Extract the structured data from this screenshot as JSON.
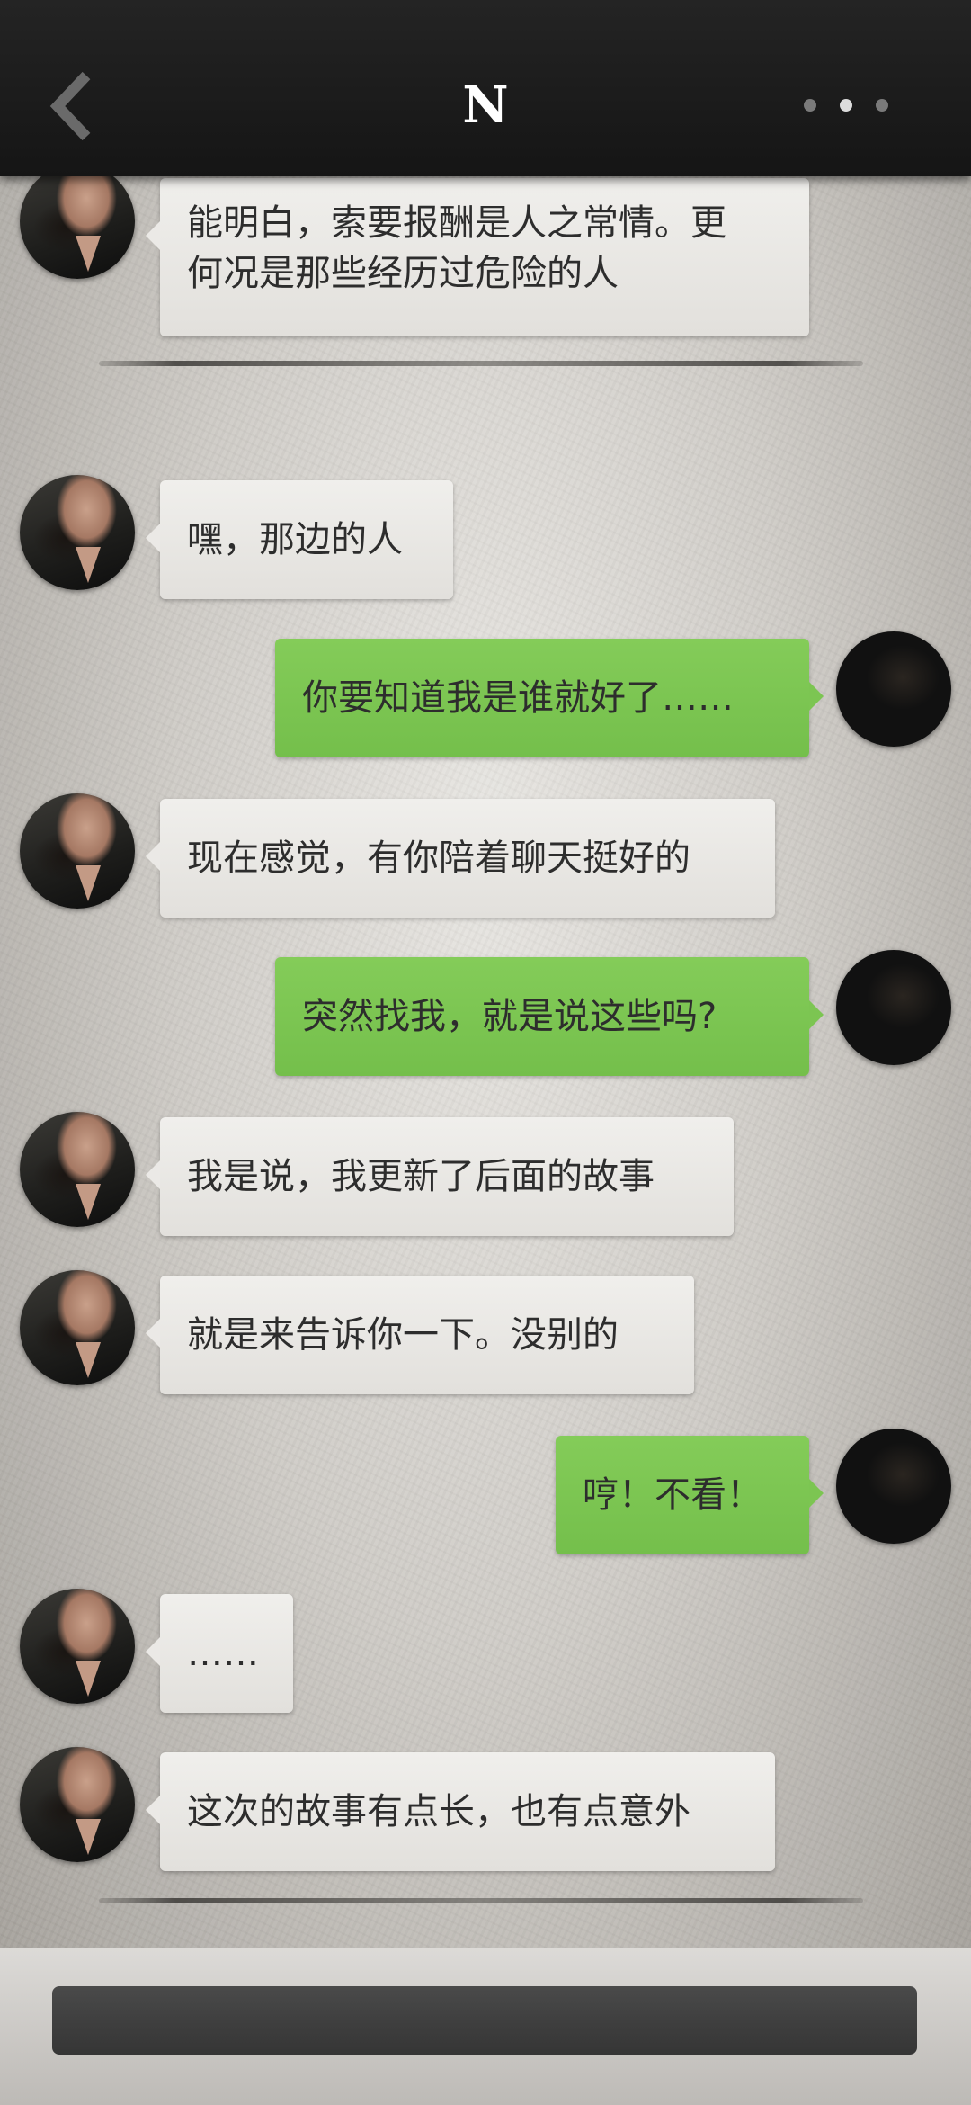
{
  "header": {
    "title": "N",
    "back_icon": "chevron-left-icon",
    "more_icon": "more-dots-icon"
  },
  "messages": [
    {
      "side": "in",
      "text_lines": [
        "能明白，索要报酬是人之常情。更",
        "何况是那些经历过危险的人"
      ]
    },
    {
      "side": "in",
      "text": "嘿，那边的人"
    },
    {
      "side": "out",
      "text": "你要知道我是谁就好了……"
    },
    {
      "side": "in",
      "text": "现在感觉，有你陪着聊天挺好的"
    },
    {
      "side": "out",
      "text": "突然找我，就是说这些吗?"
    },
    {
      "side": "in",
      "text": "我是说，我更新了后面的故事"
    },
    {
      "side": "in",
      "text": "就是来告诉你一下。没别的"
    },
    {
      "side": "out",
      "text": "哼！不看！"
    },
    {
      "side": "in",
      "text": "……"
    },
    {
      "side": "in",
      "text": "这次的故事有点长，也有点意外"
    }
  ],
  "input": {
    "placeholder": "",
    "value": ""
  },
  "colors": {
    "incoming_bubble": "#ebe9e6",
    "outgoing_bubble": "#7cc552",
    "header": "#1b1b1b"
  }
}
